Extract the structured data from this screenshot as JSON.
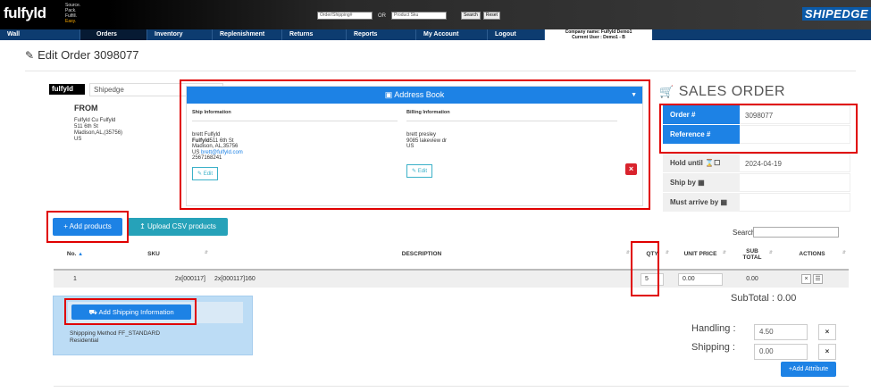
{
  "topbar": {
    "logo": "fulfyld",
    "tagline": [
      "Source.",
      "Pack.",
      "Fulfill.",
      "Easy."
    ],
    "order_search_placeholder": "Order/Shipping#",
    "or": "OR",
    "product_search_placeholder": "Product Sku",
    "search_btn": "Search",
    "reset_btn": "Reset",
    "brand": "SHIPEDGE"
  },
  "nav": [
    "Wall",
    "Orders",
    "Inventory",
    "Replenishment",
    "Returns",
    "Reports",
    "My Account",
    "Logout"
  ],
  "company": {
    "name": "Company name: Fulfyld Demo1",
    "user": "Current User : Demo1 - B"
  },
  "page_title": "Edit Order 3098077",
  "from": {
    "logo": "fulfyld",
    "carrier_select": "Shipedge",
    "label": "FROM",
    "address": [
      "Fulfyld Cu Fulfyld",
      "511 6th St",
      "Madison,AL,(35756)",
      "US"
    ]
  },
  "address_book": {
    "title": "Address Book",
    "ship_header": "Ship Information",
    "bill_header": "Billing Information",
    "ship_lines": [
      "brett Fulfyld",
      "Madison, AL,35756",
      "2567168241"
    ],
    "ship_company": "Fulfyld",
    "ship_street": "511 6th St",
    "ship_country": "US",
    "ship_email": "brett@fulfyld.com",
    "bill_lines": [
      "brett presley",
      "9085 lakeview dr",
      "US"
    ],
    "edit": "Edit"
  },
  "sales_order": {
    "title": "SALES ORDER",
    "rows": [
      {
        "label": "Order  #",
        "value": "3098077"
      },
      {
        "label": "Reference  #",
        "value": ""
      },
      {
        "label": "Hold until",
        "value": "2024-04-19"
      },
      {
        "label": "Ship by",
        "value": ""
      },
      {
        "label": "Must arrive by",
        "value": ""
      }
    ]
  },
  "buttons": {
    "add_products": "Add products",
    "upload_csv": "Upload CSV products",
    "add_shipping": "Add Shipping Information",
    "add_attribute": "Add Attribute"
  },
  "search_label": "Search:",
  "table": {
    "headers": [
      "No.",
      "SKU",
      "DESCRIPTION",
      "QTY",
      "UNIT PRICE",
      "SUB",
      "TOTAL",
      "ACTIONS"
    ],
    "rows": [
      {
        "no": "1",
        "sku": "2x[000117]",
        "desc": "2x[000117]160",
        "qty": "5",
        "price": "0.00",
        "total": "0.00"
      }
    ]
  },
  "subtotal": "SubTotal : 0.00",
  "shipping_method": [
    "Shippping Method FF_STANDARD",
    "Residential"
  ],
  "fees": {
    "handling_label": "Handling :",
    "handling_value": "4.50",
    "shipping_label": "Shipping :",
    "shipping_value": "0.00"
  }
}
